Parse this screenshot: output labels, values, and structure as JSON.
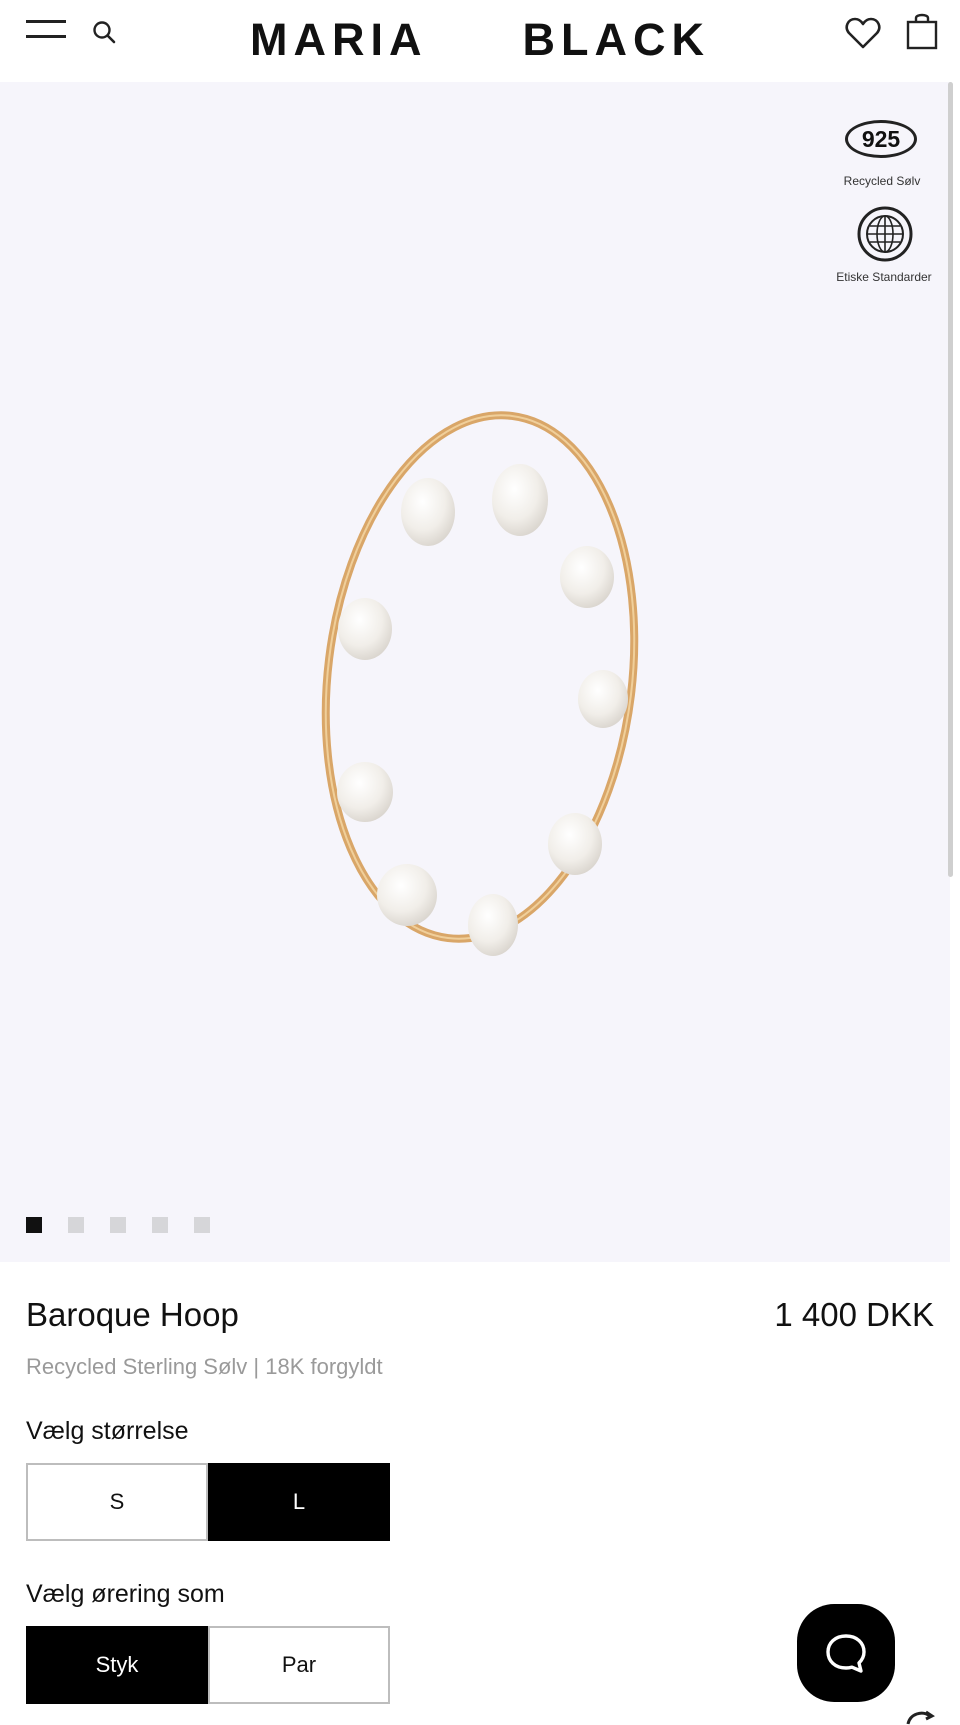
{
  "header": {
    "brand_left": "MARIA",
    "brand_right": "BLACK",
    "icons": [
      "menu-icon",
      "search-icon",
      "heart-icon",
      "bag-icon"
    ]
  },
  "badges": {
    "silver_number": "925",
    "silver_caption": "Recycled Sølv",
    "ethics_icon": "globe-icon",
    "ethics_caption": "Etiske Standarder"
  },
  "gallery": {
    "image_count": 5,
    "active_index": 0
  },
  "product": {
    "name": "Baroque Hoop",
    "price": "1 400 DKK",
    "subtitle": "Recycled Sterling Sølv | 18K forgyldt"
  },
  "size_selector": {
    "label": "Vælg størrelse",
    "options": [
      "S",
      "L"
    ],
    "selected": "L"
  },
  "type_selector": {
    "label": "Vælg ørering som",
    "options": [
      "Styk",
      "Par"
    ],
    "selected": "Styk"
  },
  "colors": {
    "hero_bg": "#f6f5fb",
    "gold": "#d9a668",
    "accent": "#000000"
  }
}
